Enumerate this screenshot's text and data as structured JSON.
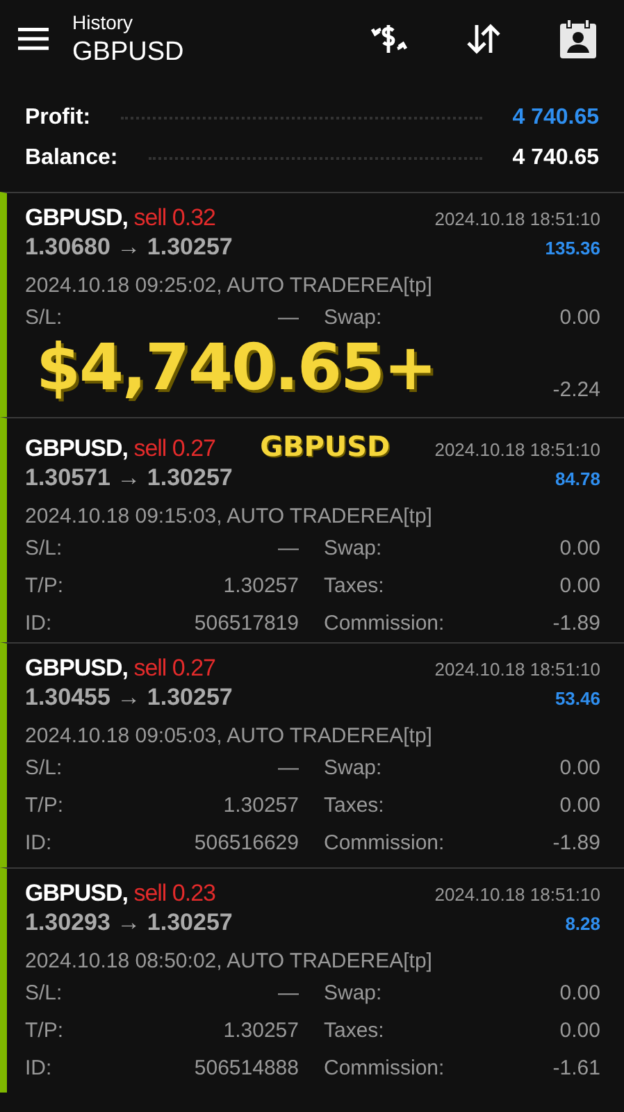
{
  "header": {
    "title": "History",
    "subtitle": "GBPUSD"
  },
  "summary": [
    {
      "label": "Profit:",
      "value": "4 740.65",
      "kind": "profit"
    },
    {
      "label": "Balance:",
      "value": "4 740.65",
      "kind": "balance"
    }
  ],
  "deals": [
    {
      "symbol": "GBPUSD,",
      "side": "sell 0.32",
      "prices": "1.30680 → 1.30257",
      "close_time": "2024.10.18 18:51:10",
      "profit": "135.36",
      "opened": "2024.10.18 09:25:02, AUTO TRADEREA[tp]",
      "details": [
        [
          "S/L:",
          "—",
          "Swap:",
          "0.00"
        ]
      ],
      "overlay": {
        "banner": "$4,740.65+",
        "visible_value": "-2.24"
      }
    },
    {
      "symbol": "GBPUSD,",
      "side": "sell 0.27",
      "tag": "GBPUSD",
      "prices": "1.30571 → 1.30257",
      "close_time": "2024.10.18 18:51:10",
      "profit": "84.78",
      "opened": "2024.10.18 09:15:03, AUTO TRADEREA[tp]",
      "details": [
        [
          "S/L:",
          "—",
          "Swap:",
          "0.00"
        ],
        [
          "T/P:",
          "1.30257",
          "Taxes:",
          "0.00"
        ],
        [
          "ID:",
          "506517819",
          "Commission:",
          "-1.89"
        ]
      ]
    },
    {
      "symbol": "GBPUSD,",
      "side": "sell 0.27",
      "prices": "1.30455 → 1.30257",
      "close_time": "2024.10.18 18:51:10",
      "profit": "53.46",
      "opened": "2024.10.18 09:05:03, AUTO TRADEREA[tp]",
      "details": [
        [
          "S/L:",
          "—",
          "Swap:",
          "0.00"
        ],
        [
          "T/P:",
          "1.30257",
          "Taxes:",
          "0.00"
        ],
        [
          "ID:",
          "506516629",
          "Commission:",
          "-1.89"
        ]
      ]
    },
    {
      "symbol": "GBPUSD,",
      "side": "sell 0.23",
      "prices": "1.30293 → 1.30257",
      "close_time": "2024.10.18 18:51:10",
      "profit": "8.28",
      "opened": "2024.10.18 08:50:02, AUTO TRADEREA[tp]",
      "details": [
        [
          "S/L:",
          "—",
          "Swap:",
          "0.00"
        ],
        [
          "T/P:",
          "1.30257",
          "Taxes:",
          "0.00"
        ],
        [
          "ID:",
          "506514888",
          "Commission:",
          "-1.61"
        ]
      ]
    }
  ]
}
